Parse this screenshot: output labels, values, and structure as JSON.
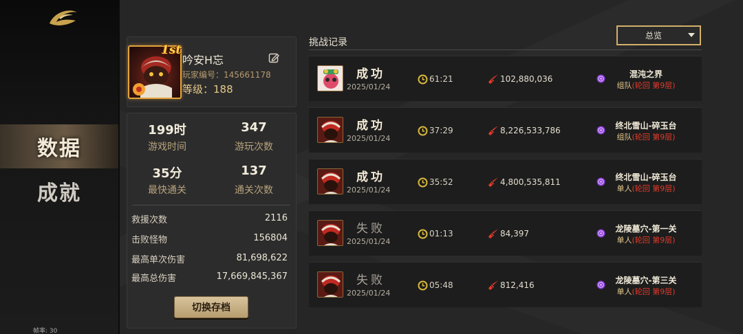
{
  "sidebar": {
    "nav": [
      {
        "label": "数据",
        "active": true
      },
      {
        "label": "成就",
        "active": false
      }
    ],
    "fps": "帧率: 30"
  },
  "profile": {
    "rank_badge": "1st",
    "name": "吟安H忘",
    "id_text": "玩家编号：145661178",
    "level_text": "等级：188"
  },
  "stats": {
    "play_time": {
      "value": "199时",
      "label": "游戏时间"
    },
    "play_count": {
      "value": "347",
      "label": "游玩次数"
    },
    "fastest": {
      "value": "35分",
      "label": "最快通关"
    },
    "clear_count": {
      "value": "137",
      "label": "通关次数"
    },
    "rows": [
      {
        "label": "救援次数",
        "value": "2116"
      },
      {
        "label": "击败怪物",
        "value": "156804"
      },
      {
        "label": "最高单次伤害",
        "value": "81,698,622"
      },
      {
        "label": "最高总伤害",
        "value": "17,669,845,367"
      }
    ],
    "switch_button": "切换存档"
  },
  "records": {
    "title": "挑战记录",
    "filter": "总览",
    "items": [
      {
        "result": "成功",
        "win": true,
        "date": "2025/01/24",
        "time": "61:21",
        "damage": "102,880,036",
        "stage": "混沌之界",
        "mode": "组队",
        "mode_detail": "(轮回  第9层)"
      },
      {
        "result": "成功",
        "win": true,
        "date": "2025/01/24",
        "time": "37:29",
        "damage": "8,226,533,786",
        "stage": "终北雪山-碎玉台",
        "mode": "组队",
        "mode_detail": "(轮回  第9层)"
      },
      {
        "result": "成功",
        "win": true,
        "date": "2025/01/24",
        "time": "35:52",
        "damage": "4,800,535,811",
        "stage": "终北雪山-碎玉台",
        "mode": "单人",
        "mode_detail": "(轮回  第9层)"
      },
      {
        "result": "失败",
        "win": false,
        "date": "2025/01/24",
        "time": "01:13",
        "damage": "84,397",
        "stage": "龙陵墓穴-第一关",
        "mode": "单人",
        "mode_detail": "(轮回  第9层)"
      },
      {
        "result": "失败",
        "win": false,
        "date": "2025/01/24",
        "time": "05:48",
        "damage": "812,416",
        "stage": "龙陵墓穴-第三关",
        "mode": "单人",
        "mode_detail": "(轮回  第9层)"
      }
    ]
  },
  "colors": {
    "accent": "#d4b06a",
    "red": "#e23a2a",
    "portal": "#8a3ad8",
    "clock": "#d8b83a"
  }
}
